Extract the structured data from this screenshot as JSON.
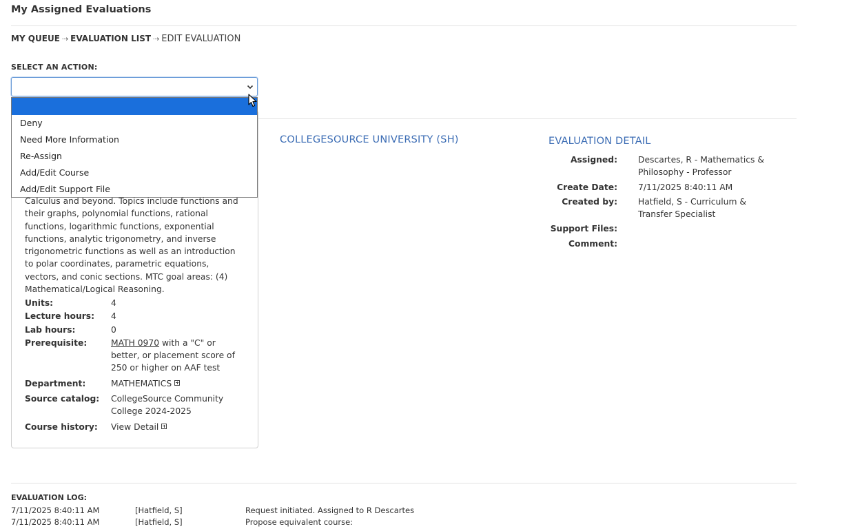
{
  "page": {
    "title": "My Assigned Evaluations"
  },
  "breadcrumb": {
    "items": [
      "MY QUEUE",
      "EVALUATION LIST"
    ],
    "current": "EDIT EVALUATION",
    "separator": "⇢"
  },
  "action": {
    "label": "SELECT AN ACTION:",
    "selected_value": "",
    "options": [
      "",
      "Deny",
      "Need More Information",
      "Re-Assign",
      "Add/Edit Course",
      "Add/Edit Support File"
    ]
  },
  "course": {
    "description": "Calculus and beyond. Topics include functions and their graphs, polynomial functions, rational functions, logarithmic functions, exponential functions, analytic trigonometry, and inverse trigonometric functions as well as an introduction to polar coordinates, parametric equations, vectors, and conic sections. MTC goal areas: (4) Mathematical/Logical Reasoning.",
    "units_label": "Units:",
    "units": "4",
    "lecture_label": "Lecture hours:",
    "lecture": "4",
    "lab_label": "Lab hours:",
    "lab": "0",
    "prereq_label": "Prerequisite:",
    "prereq_link": "MATH 0970",
    "prereq_rest": " with a \"C\" or better, or placement score of 250 or higher on AAF test",
    "department_label": "Department:",
    "department": "MATHEMATICS",
    "catalog_label": "Source catalog:",
    "catalog": "CollegeSource Community College 2024-2025",
    "history_label": "Course history:",
    "history": "View Detail"
  },
  "university": {
    "title": "COLLEGESOURCE UNIVERSITY (SH)"
  },
  "detail": {
    "title": "EVALUATION DETAIL",
    "assigned_label": "Assigned:",
    "assigned": "Descartes, R - Mathematics & Philosophy - Professor",
    "create_date_label": "Create Date:",
    "create_date": "7/11/2025 8:40:11 AM",
    "created_by_label": "Created by:",
    "created_by": "Hatfield, S - Curriculum & Transfer Specialist",
    "support_files_label": "Support Files:",
    "support_files": "",
    "comment_label": "Comment:",
    "comment": ""
  },
  "log": {
    "label": "EVALUATION LOG:",
    "rows": [
      {
        "time": "7/11/2025 8:40:11 AM",
        "user": "[Hatfield, S]",
        "message": "Request initiated. Assigned to R Descartes"
      },
      {
        "time": "7/11/2025 8:40:11 AM",
        "user": "[Hatfield, S]",
        "message": "Propose equivalent course:"
      }
    ]
  },
  "colors": {
    "accent": "#3b6cb4",
    "selection": "#1a6fdc",
    "text": "#333333"
  }
}
